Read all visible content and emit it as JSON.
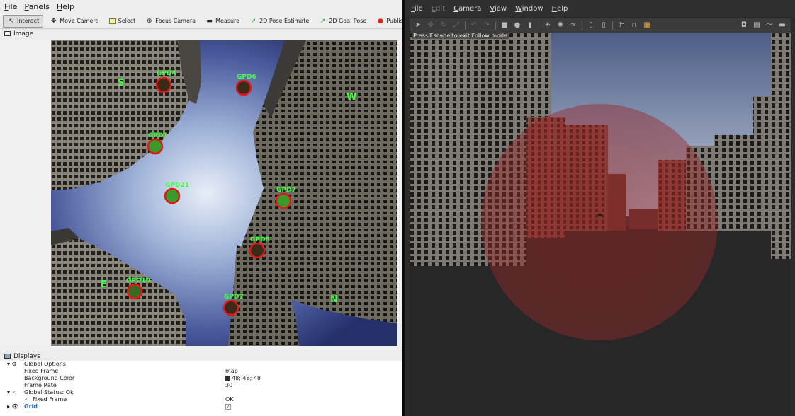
{
  "rviz": {
    "menu": [
      "File",
      "Panels",
      "Help"
    ],
    "tools": [
      {
        "label": "Interact",
        "icon": "cursor-icon",
        "active": true
      },
      {
        "label": "Move Camera",
        "icon": "move-camera-icon",
        "active": false
      },
      {
        "label": "Select",
        "icon": "select-icon",
        "active": false
      },
      {
        "label": "Focus Camera",
        "icon": "focus-camera-icon",
        "active": false
      },
      {
        "label": "Measure",
        "icon": "measure-icon",
        "active": false
      },
      {
        "label": "2D Pose Estimate",
        "icon": "pose-estimate-icon",
        "active": false
      },
      {
        "label": "2D Goal Pose",
        "icon": "goal-pose-icon",
        "active": false
      },
      {
        "label": "Publish Point",
        "icon": "publish-point-icon",
        "active": false
      }
    ],
    "image_panel_title": "Image",
    "displays_title": "Displays",
    "image": {
      "markers": [
        {
          "label": "GPD4"
        },
        {
          "label": "GPD6"
        },
        {
          "label": "GPD1"
        },
        {
          "label": "GPD21"
        },
        {
          "label": "GPD7"
        },
        {
          "label": "GPD8"
        },
        {
          "label": "GPD10"
        },
        {
          "label": "GPD7"
        }
      ],
      "compass": [
        "S",
        "W",
        "E",
        "N"
      ]
    },
    "displays": [
      {
        "key": "Global Options",
        "value": ""
      },
      {
        "key": "Fixed Frame",
        "value": "map"
      },
      {
        "key": "Background Color",
        "value": "48; 48; 48"
      },
      {
        "key": "Frame Rate",
        "value": "30"
      },
      {
        "key": "Global Status: Ok",
        "value": ""
      },
      {
        "key": "Fixed Frame",
        "value": "OK"
      },
      {
        "key": "Grid",
        "value": "✓"
      }
    ]
  },
  "gazebo": {
    "menu": [
      "File",
      "Edit",
      "Camera",
      "View",
      "Window",
      "Help"
    ],
    "hint": "Press Escape to exit Follow mode"
  },
  "colors": {
    "marker_fill": "#3a9a2a",
    "marker_ring": "#e01818",
    "label_green": "#3dff3d"
  }
}
